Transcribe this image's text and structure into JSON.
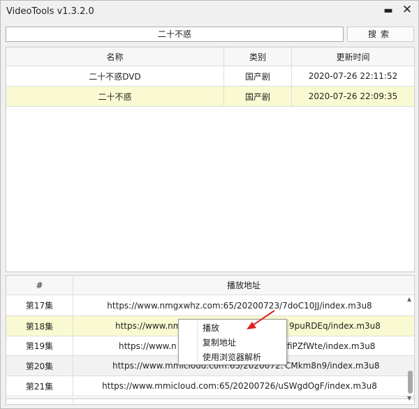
{
  "window": {
    "title": "VideoTools v1.3.2.0",
    "minimize": "▬",
    "close": "✕"
  },
  "search": {
    "value": "二十不惑",
    "button": "搜索"
  },
  "results": {
    "headers": [
      "名称",
      "类别",
      "更新时间"
    ],
    "rows": [
      [
        "二十不惑DVD",
        "国产剧",
        "2020-07-26 22:11:52"
      ],
      [
        "二十不惑",
        "国产剧",
        "2020-07-26 22:09:35"
      ]
    ]
  },
  "episodes": {
    "headers": [
      "#",
      "播放地址"
    ],
    "rows": [
      {
        "ep": "第17集",
        "url": "https://www.nmgxwhz.com:65/20200723/7doC10JJ/index.m3u8"
      },
      {
        "ep": "第18集",
        "url_left": "https://www.nm",
        "url_right": "9puRDEq/index.m3u8"
      },
      {
        "ep": "第19集",
        "url_left": "https://www.n",
        "url_right": "fiPZfWte/index.m3u8"
      },
      {
        "ep": "第20集",
        "url_left": "https://www.mmicloud.com:65/20200725/",
        "url_right": "CMkm8n9/index.m3u8"
      },
      {
        "ep": "第21集",
        "url": "https://www.mmicloud.com:65/20200726/uSWgdOgF/index.m3u8"
      }
    ]
  },
  "context_menu": {
    "items": [
      "播放",
      "复制地址",
      "使用浏览器解析"
    ]
  },
  "colors": {
    "selected_row": "#fafad2",
    "arrow": "#e02020"
  }
}
